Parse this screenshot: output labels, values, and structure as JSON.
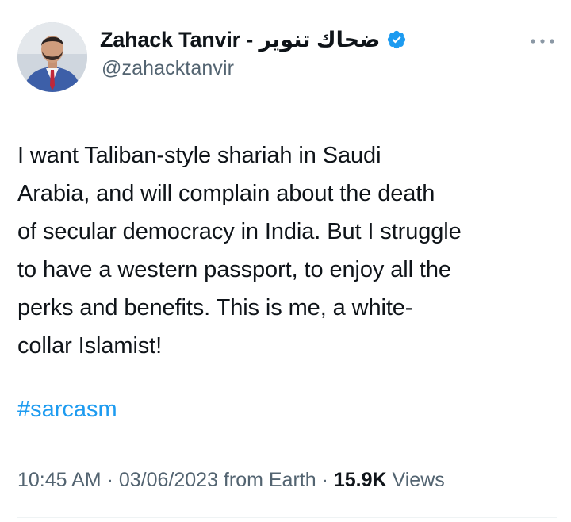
{
  "author": {
    "display_name": "Zahack Tanvir - ضحاك تنوير",
    "handle": "@zahacktanvir",
    "verified": true,
    "avatar_icon": "profile-photo"
  },
  "more_icon": "more-options-icon",
  "tweet": {
    "lines": [
      "I want Taliban-style shariah in Saudi",
      "Arabia, and will complain about the death",
      "of secular democracy in India. But I struggle",
      "to have a western passport, to enjoy all the",
      "perks and benefits. This is me, a white-",
      "collar Islamist!"
    ],
    "hashtag": "#sarcasm"
  },
  "meta": {
    "time": "10:45 AM",
    "separator": " · ",
    "date": "03/06/2023",
    "source": " from Earth",
    "views_count": "15.9K",
    "views_label": " Views"
  },
  "colors": {
    "text": "#0f1419",
    "secondary": "#536471",
    "link": "#1d9bf0",
    "verified": "#1d9bf0"
  }
}
